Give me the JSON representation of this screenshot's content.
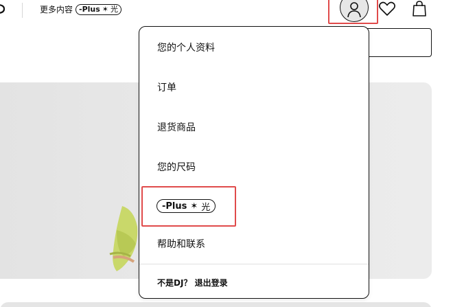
{
  "header": {
    "more_content_label": "更多内容",
    "plus_badge": {
      "prefix": "-Plus",
      "star": "✶",
      "suffix": "光"
    },
    "icons": {
      "avatar": "user-avatar-icon",
      "favorites": "heart-icon",
      "bag": "shopping-bag-icon",
      "logo": "logo-icon"
    }
  },
  "account_menu": {
    "items": [
      {
        "label": "您的个人资料"
      },
      {
        "label": "订单"
      },
      {
        "label": "退货商品"
      },
      {
        "label": "您的尺码"
      },
      {
        "label": "-Plus ✶ 光",
        "type": "plus-badge"
      },
      {
        "label": "帮助和联系"
      }
    ],
    "plus_badge": {
      "prefix": "-Plus",
      "star": "✶",
      "suffix": "光"
    },
    "sign_out": "不是DJ？ 退出登录"
  },
  "colors": {
    "highlight": "#e04a4a",
    "text": "#111111",
    "hero_background": "#e6e6e6",
    "avatar_background": "#e7e7e7",
    "figure_accent": "#c9d86a"
  }
}
